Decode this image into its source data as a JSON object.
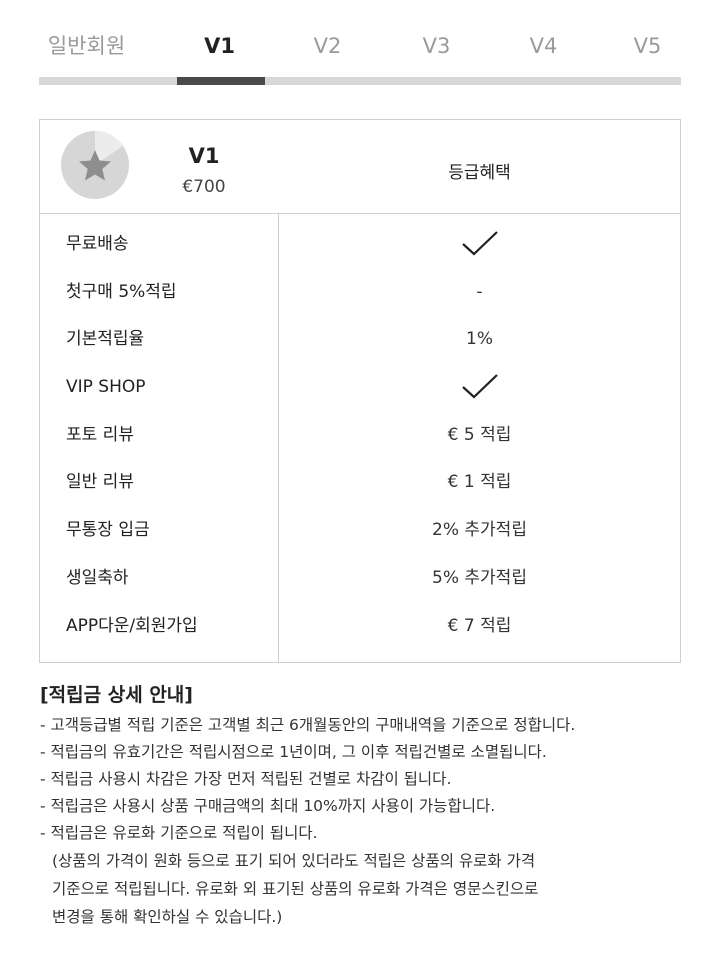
{
  "tabs": [
    {
      "label": "일반회원",
      "active": false
    },
    {
      "label": "V1",
      "active": true
    },
    {
      "label": "V2",
      "active": false
    },
    {
      "label": "V3",
      "active": false
    },
    {
      "label": "V4",
      "active": false
    },
    {
      "label": "V5",
      "active": false
    }
  ],
  "grade": {
    "name": "V1",
    "threshold": "€700",
    "icon": "star-badge-icon"
  },
  "benefits_header": "등급혜택",
  "benefits": [
    {
      "label": "무료배송",
      "value": "",
      "check": true
    },
    {
      "label": "첫구매 5%적립",
      "value": "-",
      "check": false
    },
    {
      "label": "기본적립율",
      "value": "1%",
      "check": false
    },
    {
      "label": "VIP SHOP",
      "value": "",
      "check": true
    },
    {
      "label": "포토 리뷰",
      "value": "€ 5 적립",
      "check": false
    },
    {
      "label": "일반 리뷰",
      "value": "€ 1 적립",
      "check": false
    },
    {
      "label": "무통장 입금",
      "value": "2% 추가적립",
      "check": false
    },
    {
      "label": "생일축하",
      "value": "5% 추가적립",
      "check": false
    },
    {
      "label": "APP다운/회원가입",
      "value": "€ 7 적립",
      "check": false
    }
  ],
  "info": {
    "title": "[적립금 상세 안내]",
    "lines": [
      "- 고객등급별 적립 기준은 고객별 최근 6개월동안의 구매내역을 기준으로 정합니다.",
      "- 적립금의 유효기간은 적립시점으로 1년이며, 그 이후 적립건별로 소멸됩니다.",
      "- 적립금 사용시 차감은 가장 먼저 적립된 건별로 차감이 됩니다.",
      "- 적립금은 사용시 상품 구매금액의 최대 10%까지 사용이 가능합니다.",
      "- 적립금은 유로화 기준으로 적립이 됩니다."
    ],
    "notes": [
      "(상품의 가격이 원화 등으로 표기 되어 있더라도 적립은 상품의 유로화 가격",
      " 기준으로 적립됩니다. 유로화 외 표기된 상품의 유로화 가격은 영문스킨으로",
      " 변경을 통해 확인하실 수 있습니다.)"
    ]
  },
  "colors": {
    "active_indicator": "#4a4a4a",
    "track": "#d8d8d8",
    "border": "#cfcfcf",
    "inactive_tab": "#9a9a9a"
  }
}
